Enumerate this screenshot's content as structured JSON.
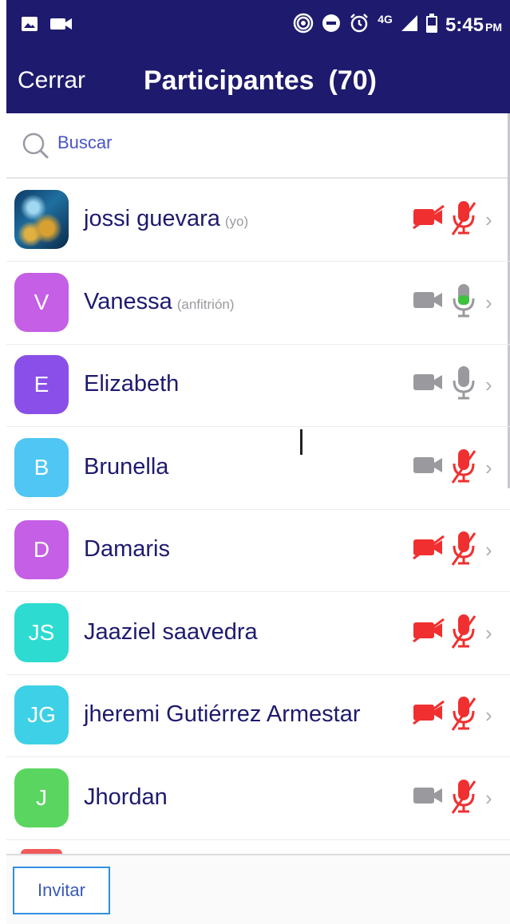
{
  "status_bar": {
    "network": "4G",
    "time": "5:45",
    "ampm": "PM",
    "icons": [
      "image-icon",
      "video-icon",
      "hotspot-icon",
      "do-not-disturb-icon",
      "alarm-icon",
      "signal-icon",
      "battery-icon"
    ]
  },
  "header": {
    "close_label": "Cerrar",
    "title": "Participantes",
    "count": "(70)",
    "background": "#1e1a6e"
  },
  "search": {
    "placeholder": "Buscar"
  },
  "participants": [
    {
      "name": "jossi guevara",
      "tag": "(yo)",
      "initials": "",
      "avatar_color": "photo",
      "camera": "off",
      "mic": "muted"
    },
    {
      "name": "Vanessa",
      "tag": "(anfitrión)",
      "initials": "V",
      "avatar_color": "#c45fe6",
      "camera": "on",
      "mic": "speaking"
    },
    {
      "name": "Elizabeth",
      "tag": "",
      "initials": "E",
      "avatar_color": "#8a4fe8",
      "camera": "on",
      "mic": "on"
    },
    {
      "name": "Brunella",
      "tag": "",
      "initials": "B",
      "avatar_color": "#4fc6f3",
      "camera": "on",
      "mic": "muted"
    },
    {
      "name": "Damaris",
      "tag": "",
      "initials": "D",
      "avatar_color": "#c45fe6",
      "camera": "off",
      "mic": "muted"
    },
    {
      "name": "Jaaziel saavedra",
      "tag": "",
      "initials": "JS",
      "avatar_color": "#2ddbd0",
      "camera": "off",
      "mic": "muted"
    },
    {
      "name": "jheremi Gutiérrez Armestar",
      "tag": "",
      "initials": "JG",
      "avatar_color": "#3ed0e6",
      "camera": "off",
      "mic": "muted"
    },
    {
      "name": "Jhordan",
      "tag": "",
      "initials": "J",
      "avatar_color": "#5ad660",
      "camera": "on",
      "mic": "muted"
    }
  ],
  "footer": {
    "invite_label": "Invitar"
  },
  "colors": {
    "muted_red": "#f03030",
    "icon_gray": "#9a9a9e",
    "speaking_green": "#3cc23c",
    "text_navy": "#1e1a6e"
  }
}
